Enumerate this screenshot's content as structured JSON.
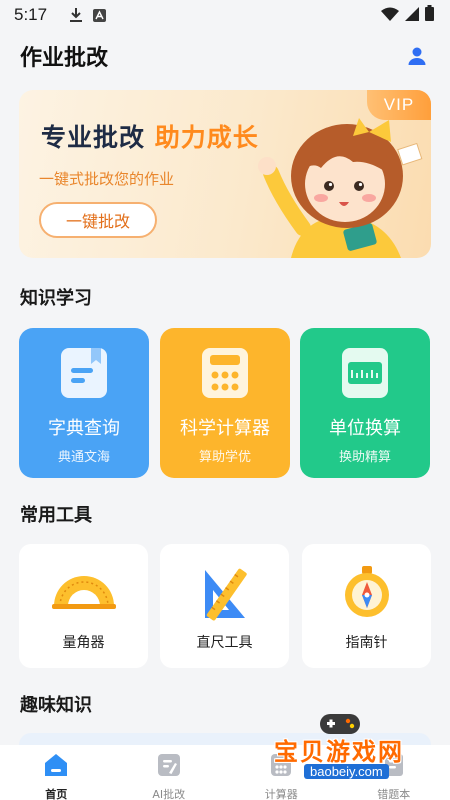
{
  "status_bar": {
    "time": "5:17"
  },
  "header": {
    "title": "作业批改"
  },
  "banner": {
    "vip": "VIP",
    "slogan_main": "专业批改",
    "slogan_accent": "助力成长",
    "subtitle": "一键式批改您的作业",
    "cta": "一键批改"
  },
  "knowledge": {
    "title": "知识学习",
    "cards": [
      {
        "name": "字典查询",
        "sub": "典通文海",
        "color": "#4aa3f5",
        "icon": "book-icon"
      },
      {
        "name": "科学计算器",
        "sub": "算助学优",
        "color": "#fdb52c",
        "icon": "calculator-icon"
      },
      {
        "name": "单位换算",
        "sub": "换助精算",
        "color": "#22c98a",
        "icon": "ruler-scale-icon"
      }
    ]
  },
  "tools": {
    "title": "常用工具",
    "items": [
      {
        "name": "量角器",
        "icon": "protractor-icon"
      },
      {
        "name": "直尺工具",
        "icon": "set-square-icon"
      },
      {
        "name": "指南针",
        "icon": "compass-icon"
      }
    ]
  },
  "fun": {
    "title": "趣味知识"
  },
  "tabbar": {
    "tabs": [
      {
        "label": "首页",
        "icon": "home-icon",
        "active": true
      },
      {
        "label": "AI批改",
        "icon": "ai-grade-icon",
        "active": false
      },
      {
        "label": "计算器",
        "icon": "calculator-tab-icon",
        "active": false
      },
      {
        "label": "错题本",
        "icon": "notebook-icon",
        "active": false
      }
    ]
  },
  "watermark": {
    "cn": "宝贝游戏网",
    "en": "baobeiy.com"
  }
}
